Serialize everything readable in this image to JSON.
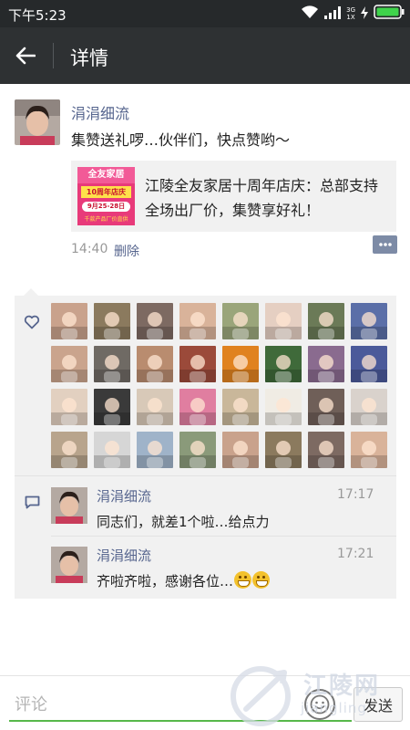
{
  "status_bar": {
    "time": "下午5:23",
    "network_top": "3G",
    "network_bottom": "1X",
    "icons": [
      "wifi-icon",
      "signal-icon",
      "charging-icon",
      "battery-icon"
    ]
  },
  "header": {
    "title": "详情",
    "back_icon": "arrow-left-icon"
  },
  "post": {
    "author": "涓涓细流",
    "text": "集赞送礼啰…伙伴们，快点赞哟～",
    "share": {
      "title": "江陵全友家居十周年店庆：总部支持全场出厂价，集赞享好礼！",
      "thumb_brand": "全友家居",
      "thumb_banner": "10周年店庆",
      "thumb_date": "9月25-28日",
      "thumb_footer": "千款产品厂价直供"
    },
    "time": "14:40",
    "delete_label": "删除"
  },
  "likes": {
    "icon": "heart-icon",
    "count": 32
  },
  "comments": [
    {
      "author": "涓涓细流",
      "text": "同志们，就差1个啦…给点力",
      "time": "17:17",
      "emojis": 0
    },
    {
      "author": "涓涓细流",
      "text": "齐啦齐啦，感谢各位…",
      "time": "17:21",
      "emojis": 2
    }
  ],
  "comment_bar": {
    "placeholder": "评论",
    "send_label": "发送"
  },
  "watermark": {
    "title": "江陵网",
    "subtitle": "jiangling"
  },
  "colors": {
    "status_bar": "#26292b",
    "app_bar": "#2e3133",
    "name_link": "#56658e",
    "panel": "#f1f1f1",
    "input_underline": "#57b84a"
  }
}
